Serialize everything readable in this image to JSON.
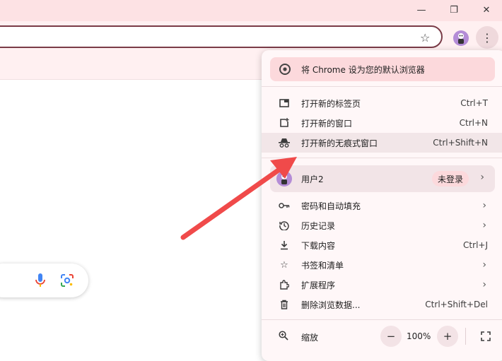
{
  "window": {
    "minimize_glyph": "—",
    "restore_glyph": "❐",
    "close_glyph": "✕"
  },
  "toolbar": {
    "star_glyph": "☆",
    "menu_glyph": "⋮"
  },
  "menu": {
    "default_banner": "将 Chrome 设为您的默认浏览器",
    "items_top": [
      {
        "label": "打开新的标签页",
        "shortcut": "Ctrl+T",
        "icon": "new-tab-icon"
      },
      {
        "label": "打开新的窗口",
        "shortcut": "Ctrl+N",
        "icon": "new-window-icon"
      },
      {
        "label": "打开新的无痕式窗口",
        "shortcut": "Ctrl+Shift+N",
        "icon": "incognito-icon"
      }
    ],
    "profile": {
      "name": "用户2",
      "status": "未登录"
    },
    "items_mid": [
      {
        "label": "密码和自动填充",
        "icon": "key-icon"
      },
      {
        "label": "历史记录",
        "icon": "history-icon"
      },
      {
        "label": "下载内容",
        "shortcut": "Ctrl+J",
        "icon": "download-icon"
      },
      {
        "label": "书签和清单",
        "icon": "star-icon"
      },
      {
        "label": "扩展程序",
        "icon": "extension-icon"
      },
      {
        "label": "删除浏览数据...",
        "shortcut": "Ctrl+Shift+Del",
        "icon": "trash-icon"
      }
    ],
    "zoom": {
      "label": "缩放",
      "value": "100%",
      "minus": "−",
      "plus": "+"
    }
  },
  "colors": {
    "arrow": "#f04a4a",
    "accent": "#fcd9dc"
  }
}
